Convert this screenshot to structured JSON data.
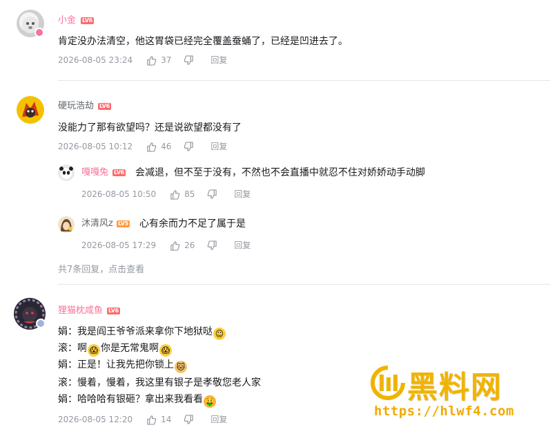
{
  "comments": [
    {
      "username": "小金",
      "level": "LV6",
      "text": "肯定没办法清空，他这胃袋已经完全覆盖蚕蛹了，已经是凹进去了。",
      "time": "2026-08-05 23:24",
      "likes": "37",
      "reply_label": "回复"
    },
    {
      "username": "硬玩浩劫",
      "level": "LV6",
      "text": "没能力了那有欲望吗？还是说欲望都没有了",
      "time": "2026-08-05 10:12",
      "likes": "46",
      "reply_label": "回复",
      "replies": [
        {
          "username": "嘎嘎兔",
          "level": "LV6",
          "text": "会减退，但不至于没有，不然也不会直播中就忍不住对娇娇动手动脚",
          "time": "2026-08-05 10:50",
          "likes": "85",
          "reply_label": "回复"
        },
        {
          "username": "沐清风z",
          "level": "LV5",
          "text": "心有余而力不足了属于是",
          "time": "2026-08-05 17:29",
          "likes": "26",
          "reply_label": "回复"
        }
      ],
      "more_replies": "共7条回复，点击查看"
    },
    {
      "username": "狸猫枕咸鱼",
      "level": "LV6",
      "lines": [
        {
          "text": "娟：我是阎王爷爷派来拿你下地狱哒",
          "emoji_after": "smile-emoji"
        },
        {
          "text_a": "滚：啊",
          "text_b": "你是无常鬼啊",
          "emoji": "scream-emoji"
        },
        {
          "text": "娟：正是！让我先把你锁上",
          "emoji_after": "cat-emoji"
        },
        {
          "text": "滚：慢着，慢着，我这里有银子是孝敬您老人家"
        },
        {
          "text": "娟：哈哈哈有银砸？拿出来我看看",
          "emoji_after": "greedy-emoji"
        }
      ],
      "time": "2026-08-05 12:20",
      "likes": "14",
      "reply_label": "回复"
    }
  ],
  "watermark": {
    "title": "黑料网",
    "url": "https://hlwf4.com"
  },
  "colors": {
    "username_pink": "#fb7299",
    "username_gray": "#61666d",
    "meta_gray": "#9499a0",
    "watermark_gold": "#f0b400"
  }
}
